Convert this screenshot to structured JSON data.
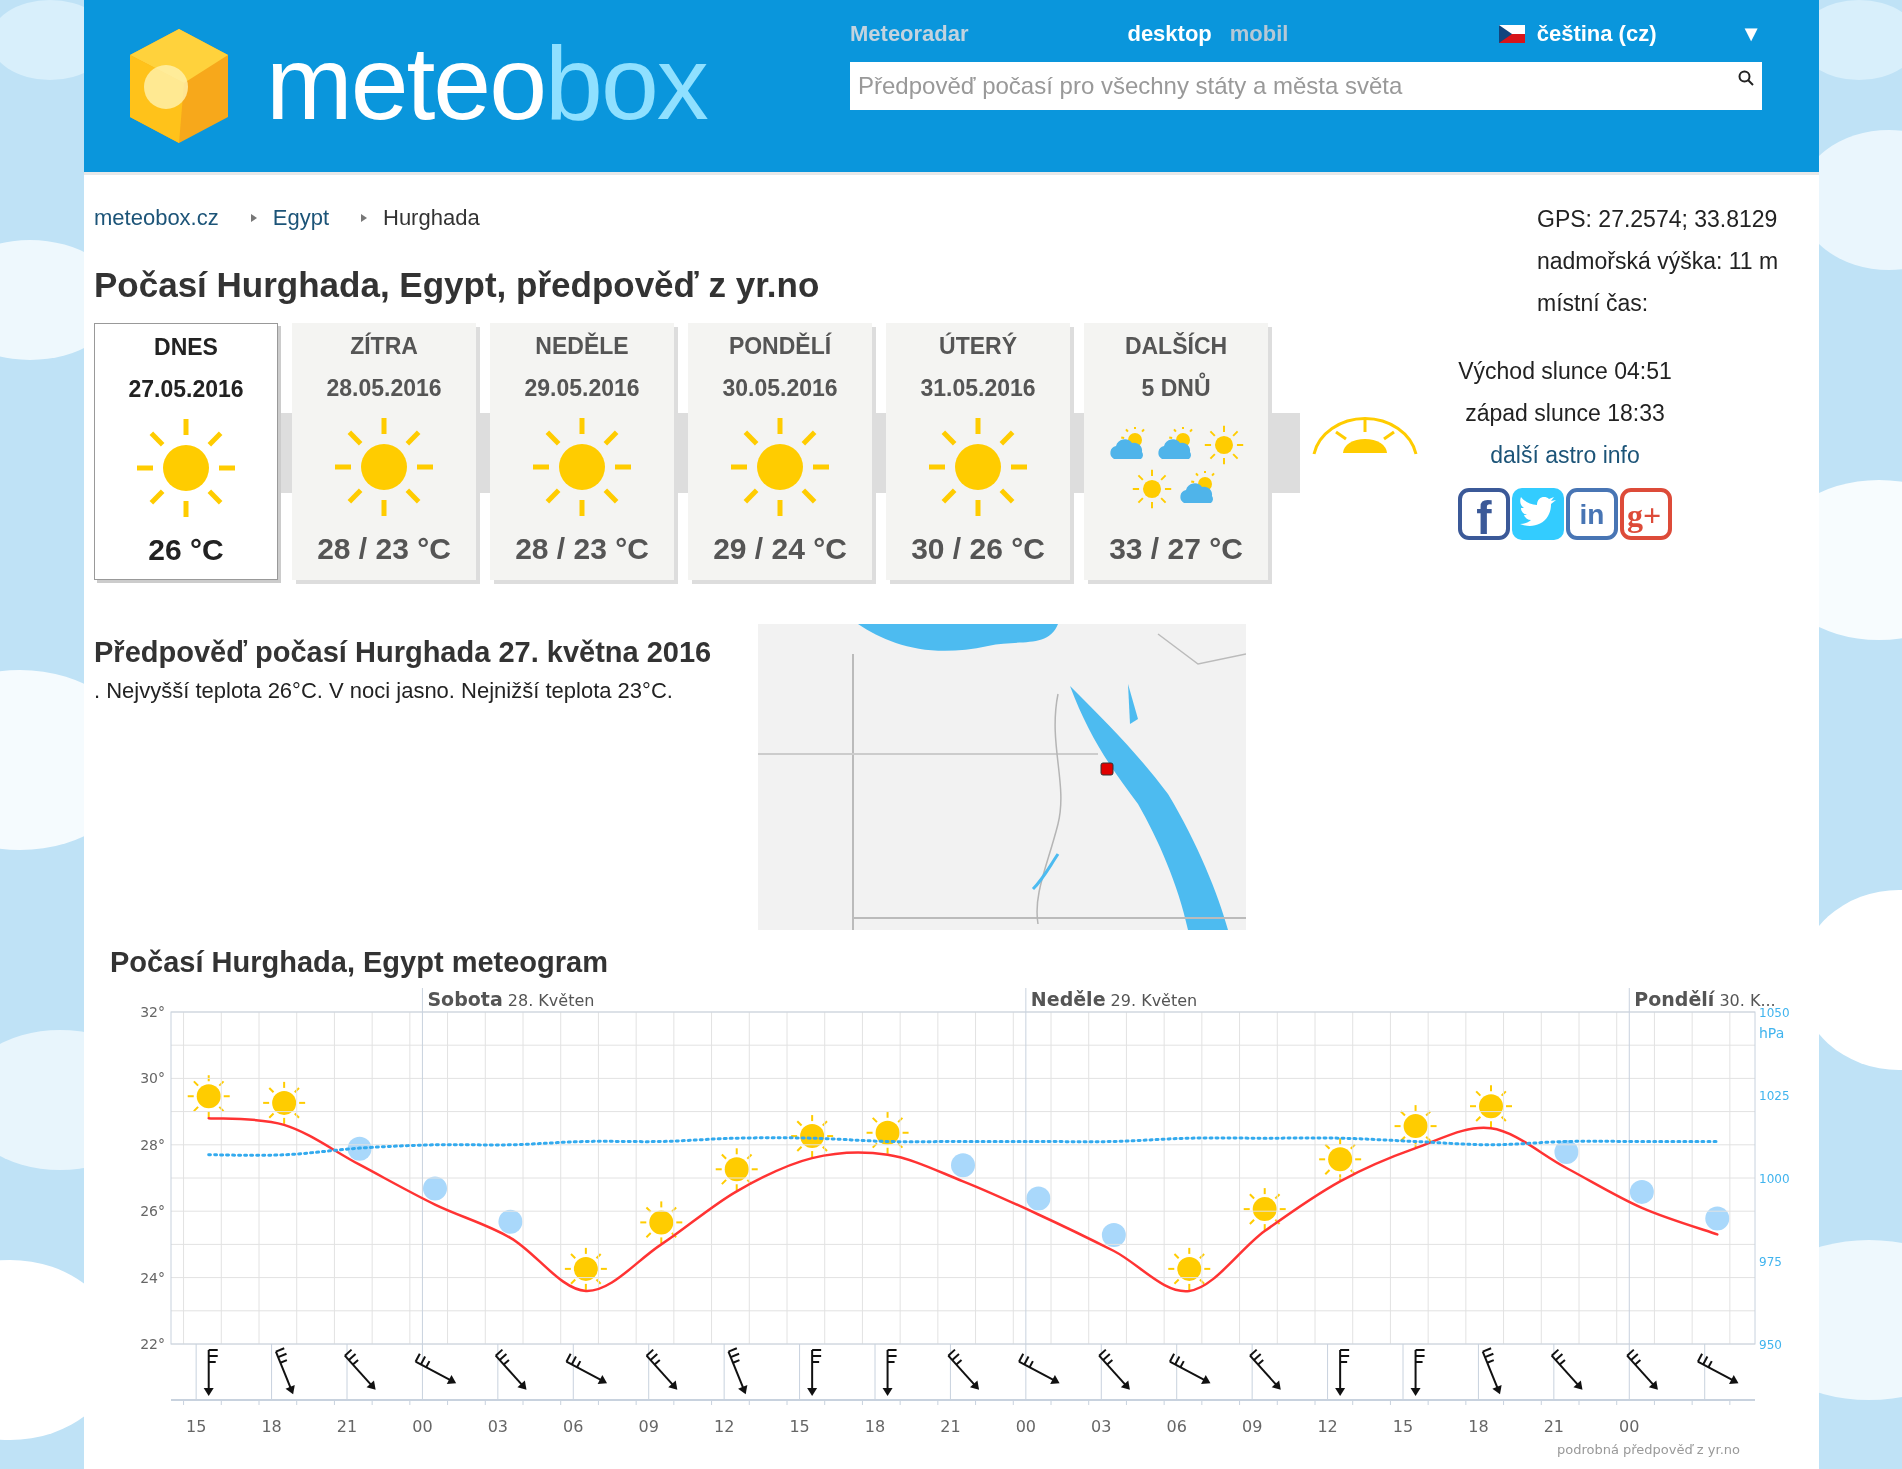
{
  "header": {
    "logo": {
      "part_1": "meteo",
      "part_2": "box"
    },
    "nav": [
      {
        "label": "Meteoradar"
      }
    ],
    "view_modes": [
      {
        "label": "desktop",
        "selected": true
      },
      {
        "label": "mobil",
        "selected": false
      }
    ],
    "language": {
      "label": "čeština (cz)",
      "toggle": "▼"
    },
    "search": {
      "placeholder": "Předpověď počasí pro všechny státy a města světa"
    }
  },
  "breadcrumb": [
    {
      "label": "meteobox.cz",
      "link": true
    },
    {
      "label": "Egypt",
      "link": true
    },
    {
      "label": "Hurghada",
      "link": false
    }
  ],
  "title": "Počasí Hurghada, Egypt, předpověď z yr.no",
  "days": [
    {
      "label": "DNES",
      "sublabel": "27.05.2016",
      "icons": [
        {
          "kind": "sun"
        }
      ],
      "temp": "26 °C",
      "selected": true
    },
    {
      "label": "ZÍTRA",
      "sublabel": "28.05.2016",
      "icons": [
        {
          "kind": "sun"
        }
      ],
      "temp": "28 / 23 °C",
      "selected": false
    },
    {
      "label": "NEDĚLE",
      "sublabel": "29.05.2016",
      "icons": [
        {
          "kind": "sun"
        }
      ],
      "temp": "28 / 23 °C",
      "selected": false
    },
    {
      "label": "PONDĚLÍ",
      "sublabel": "30.05.2016",
      "icons": [
        {
          "kind": "sun"
        }
      ],
      "temp": "29 / 24 °C",
      "selected": false
    },
    {
      "label": "ÚTERÝ",
      "sublabel": "31.05.2016",
      "icons": [
        {
          "kind": "sun"
        }
      ],
      "temp": "30 / 26 °C",
      "selected": false
    },
    {
      "label": "DALŠÍCH",
      "sublabel": "5 DNŮ",
      "icons": [
        {
          "kind": "partly_cloudy"
        },
        {
          "kind": "partly_cloudy"
        },
        {
          "kind": "sun"
        },
        {
          "kind": "sun"
        },
        {
          "kind": "partly_cloudy"
        }
      ],
      "temp": "33 / 27 °C",
      "selected": false
    }
  ],
  "location": {
    "gps": "GPS: 27.2574; 33.8129",
    "altitude": "nadmořská výška: 11 m",
    "local_time": "místní čas:"
  },
  "astro": {
    "sunrise": "Východ slunce 04:51",
    "sunset": "západ slunce 18:33",
    "link": "další astro info"
  },
  "social": [
    {
      "kind": "facebook",
      "glyph": "f"
    },
    {
      "kind": "twitter"
    },
    {
      "kind": "linkedin",
      "glyph": "in"
    },
    {
      "kind": "googleplus",
      "glyph": "g+"
    }
  ],
  "forecast": {
    "heading": "Předpověď počasí Hurghada 27. května 2016",
    "text": ". Nejvyšší teplota 26°C. V noci jasno. Nejnižší teplota 23°C."
  },
  "meteogram": {
    "title": "Počasí Hurghada, Egypt meteogram",
    "chart_data": {
      "type": "line",
      "grid": true,
      "categories": [
        "15",
        "18",
        "21",
        "00",
        "03",
        "06",
        "09",
        "12",
        "15",
        "18",
        "21",
        "00",
        "03",
        "06",
        "09",
        "12",
        "15",
        "18",
        "21",
        "00",
        null
      ],
      "series": [
        {
          "color": "#ff3333",
          "values": [
            28.8,
            28.6,
            27.4,
            26.2,
            25.2,
            23.6,
            25.0,
            26.6,
            27.6,
            27.7,
            26.9,
            25.9,
            24.8,
            23.6,
            25.4,
            26.9,
            27.9,
            28.5,
            27.3,
            26.1,
            25.3
          ]
        },
        {
          "color": "#33aaee",
          "axis": "y2",
          "line_style": "dotted",
          "values": [
            1007,
            1007,
            1009,
            1010,
            1010,
            1011,
            1011,
            1012,
            1012,
            1011,
            1011,
            1011,
            1011,
            1012,
            1012,
            1012,
            1011,
            1010,
            1011,
            1011,
            1011
          ]
        }
      ],
      "ylim": [
        22,
        32
      ],
      "y2lim": [
        950,
        1050
      ],
      "y2label": "hPa",
      "yticks": [
        {
          "value": 22,
          "label": "22°"
        },
        {
          "value": 24,
          "label": "24°"
        },
        {
          "value": 26,
          "label": "26°"
        },
        {
          "value": 28,
          "label": "28°"
        },
        {
          "value": 30,
          "label": "30°"
        },
        {
          "value": 32,
          "label": "32°"
        }
      ],
      "y2ticks": [
        {
          "value": 950,
          "label": "950"
        },
        {
          "value": 975,
          "label": "975"
        },
        {
          "value": 1000,
          "label": "1000"
        },
        {
          "value": 1025,
          "label": "1025"
        },
        {
          "value": 1050,
          "label": "1050"
        }
      ],
      "annotations": [
        "**Sobota** 28. Květen",
        "**Neděle** 29. Květen",
        "**Pondělí** 30. K..."
      ]
    },
    "symbols": [
      {
        "kind": "sun"
      },
      {
        "kind": "sun"
      },
      {
        "kind": "night"
      },
      {
        "kind": "night"
      },
      {
        "kind": "night"
      },
      {
        "kind": "sun"
      },
      {
        "kind": "sun"
      },
      {
        "kind": "sun"
      },
      {
        "kind": "sun"
      },
      {
        "kind": "sun"
      },
      {
        "kind": "night"
      },
      {
        "kind": "night"
      },
      {
        "kind": "night"
      },
      {
        "kind": "sun"
      },
      {
        "kind": "sun"
      },
      {
        "kind": "sun"
      },
      {
        "kind": "sun"
      },
      {
        "kind": "sun"
      },
      {
        "kind": "night"
      },
      {
        "kind": "night"
      },
      {
        "kind": "night"
      }
    ],
    "wind": [
      {
        "kind": "s"
      },
      {
        "kind": "sse"
      },
      {
        "kind": "se"
      },
      {
        "kind": "ese"
      },
      {
        "kind": "se"
      },
      {
        "kind": "ese"
      },
      {
        "kind": "se"
      },
      {
        "kind": "sse"
      },
      {
        "kind": "s"
      },
      {
        "kind": "s"
      },
      {
        "kind": "se"
      },
      {
        "kind": "ese"
      },
      {
        "kind": "se"
      },
      {
        "kind": "ese"
      },
      {
        "kind": "se"
      },
      {
        "kind": "s"
      },
      {
        "kind": "s"
      },
      {
        "kind": "sse"
      },
      {
        "kind": "se"
      },
      {
        "kind": "se"
      },
      {
        "kind": "ese"
      }
    ],
    "source": "podrobná předpověď z yr.no"
  }
}
